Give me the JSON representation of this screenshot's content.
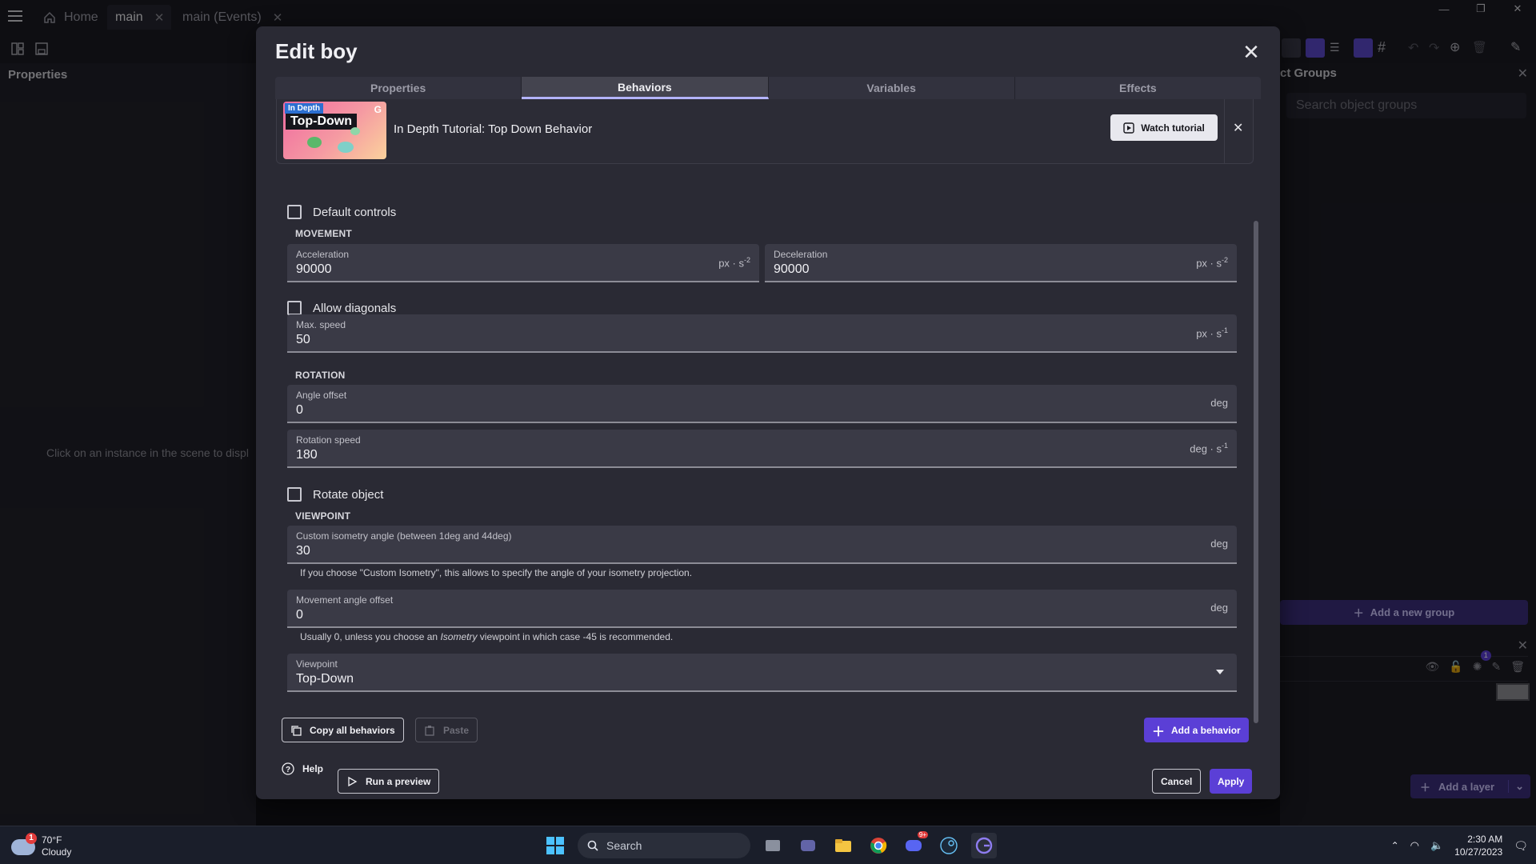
{
  "app": {
    "tabs": [
      {
        "label": "Home"
      },
      {
        "label": "main"
      },
      {
        "label": "main (Events)"
      }
    ],
    "left_panel": {
      "title": "Properties",
      "hint": "Click on an instance in the scene to displ"
    },
    "right_panel": {
      "title": "ct Groups",
      "search_placeholder": "Search object groups",
      "add_group_label": "Add a new group",
      "layer_badge": "1",
      "add_layer_label": "Add a layer"
    }
  },
  "dialog": {
    "title": "Edit boy",
    "tabs": [
      "Properties",
      "Behaviors",
      "Variables",
      "Effects"
    ],
    "active_tab": "Behaviors",
    "tutorial": {
      "badge": "In Depth",
      "thumb_title": "Top-Down",
      "title": "In Depth Tutorial: Top Down Behavior",
      "watch_label": "Watch tutorial"
    },
    "default_controls_label": "Default controls",
    "movement_section": "MOVEMENT",
    "acceleration": {
      "label": "Acceleration",
      "value": "90000",
      "unit_base": "px · s",
      "unit_exp": "-2"
    },
    "deceleration": {
      "label": "Deceleration",
      "value": "90000",
      "unit_base": "px · s",
      "unit_exp": "-2"
    },
    "allow_diagonals_label": "Allow diagonals",
    "max_speed": {
      "label": "Max. speed",
      "value": "50",
      "unit_base": "px · s",
      "unit_exp": "-1"
    },
    "rotation_section": "ROTATION",
    "angle_offset": {
      "label": "Angle offset",
      "value": "0",
      "unit": "deg"
    },
    "rotation_speed": {
      "label": "Rotation speed",
      "value": "180",
      "unit_base": "deg · s",
      "unit_exp": "-1"
    },
    "rotate_object_label": "Rotate object",
    "viewpoint_section": "VIEWPOINT",
    "custom_isometry": {
      "label": "Custom isometry angle (between 1deg and 44deg)",
      "value": "30",
      "unit": "deg"
    },
    "custom_isometry_help": "If you choose \"Custom Isometry\", this allows to specify the angle of your isometry projection.",
    "movement_angle_offset": {
      "label": "Movement angle offset",
      "value": "0",
      "unit": "deg"
    },
    "movement_help_pre": "Usually 0, unless you choose an ",
    "movement_help_em": "Isometry",
    "movement_help_post": " viewpoint in which case -45 is recommended.",
    "viewpoint": {
      "label": "Viewpoint",
      "value": "Top-Down"
    },
    "copy_all_label": "Copy all behaviors",
    "paste_label": "Paste",
    "add_behavior_label": "Add a behavior",
    "help_label": "Help",
    "run_preview_label": "Run a preview",
    "cancel_label": "Cancel",
    "apply_label": "Apply"
  },
  "taskbar": {
    "weather_temp": "70°F",
    "weather_desc": "Cloudy",
    "weather_badge": "1",
    "search_label": "Search",
    "discord_badge": "9+",
    "time": "2:30 AM",
    "date": "10/27/2023"
  },
  "colors": {
    "accent": "#5b3fd6",
    "dialog_bg": "#2a2a34",
    "field_bg": "#3a3a46"
  }
}
